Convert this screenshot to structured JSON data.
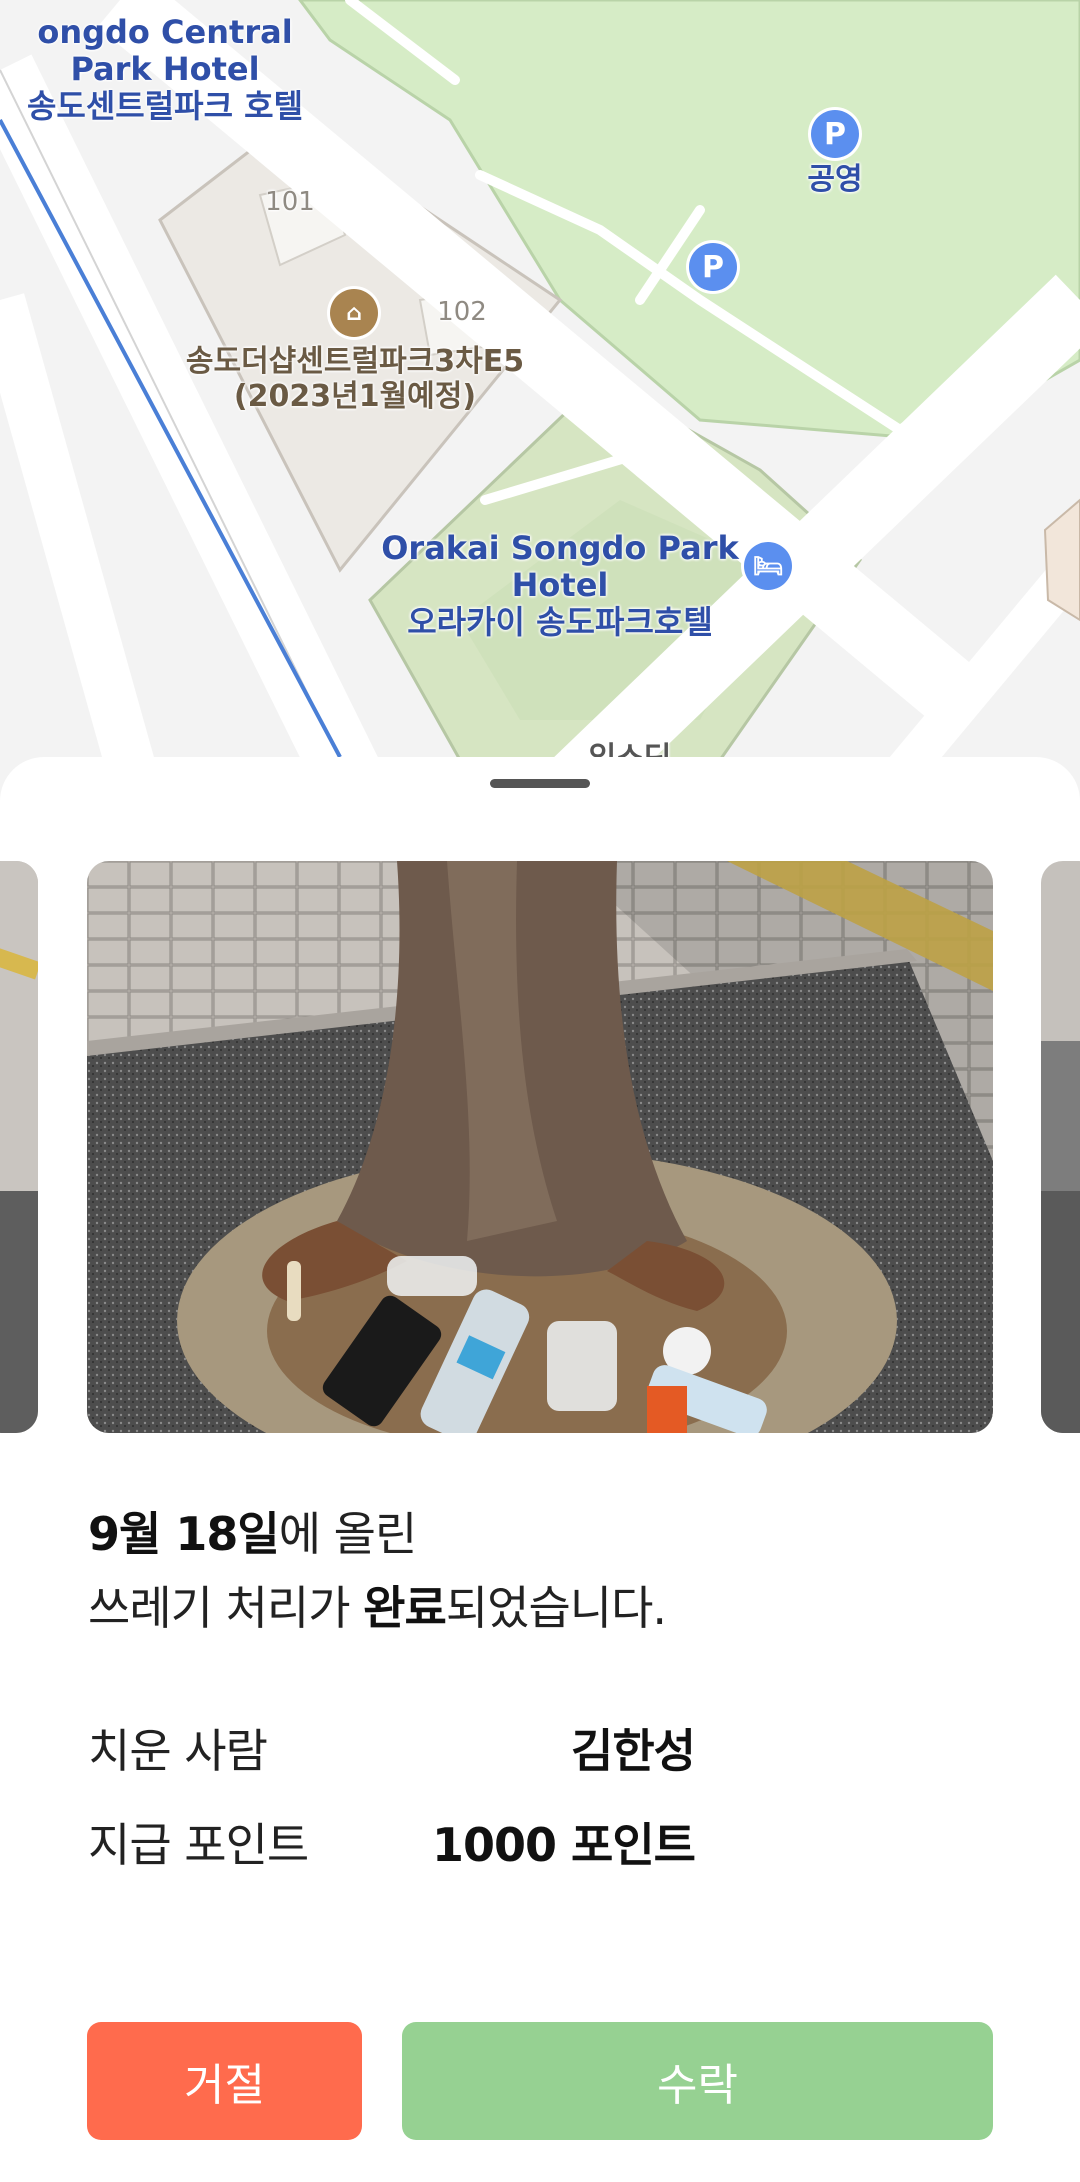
{
  "map": {
    "labels": {
      "hotel_top_en": "ongdo Central Park Hotel",
      "hotel_top_ko": "송도센트럴파크 호텔",
      "parking_public": "공영",
      "bldg_101": "101",
      "bldg_102": "102",
      "complex_name": "송도더샵센트럴파크3차E5",
      "complex_note": "(2023년1월예정)",
      "orakai_en": "Orakai Songdo Park Hotel",
      "orakai_ko": "오라카이 송도파크호텔",
      "cutoff_label": "입소딘"
    },
    "icons": [
      "parking-icon",
      "building-icon",
      "hotel-bed-icon"
    ],
    "colors": {
      "park": "#d6ecc6",
      "parking_pin": "#5b8fef",
      "building_pin": "#a98450",
      "route": "#4a7fd6"
    }
  },
  "sheet": {
    "message": {
      "date": "9월 18일",
      "line1_rest": "에 올린",
      "line2_prefix": "쓰레기 처리가 ",
      "line2_bold": "완료",
      "line2_suffix": "되었습니다."
    },
    "rows": [
      {
        "label": "치운 사람",
        "value": "김한성"
      },
      {
        "label": "지급 포인트",
        "value": "1000 포인트"
      }
    ],
    "buttons": {
      "reject": "거절",
      "accept": "수락"
    },
    "colors": {
      "reject": "#ff6b4d",
      "accept": "#96d192"
    }
  }
}
